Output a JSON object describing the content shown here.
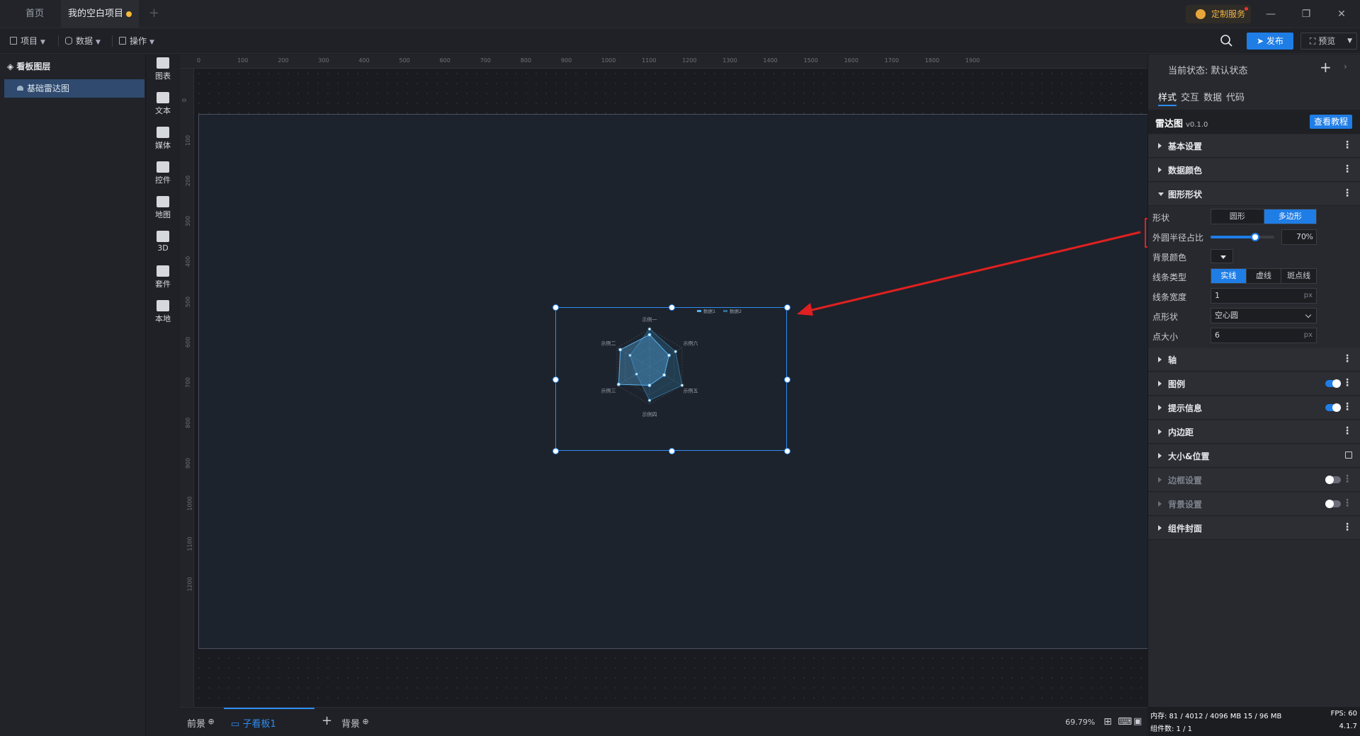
{
  "titlebar": {
    "tabs": [
      {
        "label": "首页"
      },
      {
        "label": "我的空白项目"
      }
    ],
    "service_label": "定制服务"
  },
  "toolbar": {
    "menus": [
      {
        "label": "项目"
      },
      {
        "label": "数据"
      },
      {
        "label": "操作"
      }
    ],
    "publish_label": "发布",
    "preview_label": "预览"
  },
  "layers": {
    "title": "看板图层",
    "items": [
      {
        "label": "基础雷达图"
      }
    ]
  },
  "components": [
    {
      "label": "图表",
      "icon": "chart-icon"
    },
    {
      "label": "文本",
      "icon": "text-icon"
    },
    {
      "label": "媒体",
      "icon": "media-icon"
    },
    {
      "label": "控件",
      "icon": "control-icon"
    },
    {
      "label": "地图",
      "icon": "map-icon"
    },
    {
      "label": "3D",
      "icon": "cube-icon"
    },
    {
      "label": "套件",
      "icon": "kit-icon"
    },
    {
      "label": "本地",
      "icon": "puzzle-icon"
    }
  ],
  "ruler": {
    "top": [
      "0",
      "100",
      "200",
      "300",
      "400",
      "500",
      "600",
      "700",
      "800",
      "900",
      "1000",
      "1100",
      "1200",
      "1300",
      "1400",
      "1500",
      "1600",
      "1700",
      "1800",
      "1900"
    ],
    "left": [
      "0",
      "100",
      "200",
      "300",
      "400",
      "500",
      "600",
      "700",
      "800",
      "900",
      "1000",
      "1100",
      "1200"
    ]
  },
  "chart_data": {
    "type": "radar",
    "indicators": [
      "示例一",
      "示例六",
      "示例五",
      "示例四",
      "示例三",
      "示例二"
    ],
    "max": 100,
    "series": [
      {
        "name": "数据1",
        "color": "#5ab1ef",
        "values": [
          85,
          60,
          45,
          50,
          95,
          90
        ]
      },
      {
        "name": "数据2",
        "color": "#2f6e94",
        "values": [
          100,
          80,
          100,
          90,
          40,
          60
        ]
      }
    ],
    "legend": "top-right"
  },
  "bottombar": {
    "tabs": [
      {
        "label": "前景"
      },
      {
        "label": "子看板1"
      },
      {
        "label": "背景"
      }
    ],
    "zoom": "69.79%"
  },
  "panel": {
    "state_label": "当前状态:",
    "state_value": "默认状态",
    "tabs": [
      {
        "label": "样式"
      },
      {
        "label": "交互"
      },
      {
        "label": "数据"
      },
      {
        "label": "代码"
      }
    ],
    "component_name": "雷达图",
    "component_version": "v0.1.0",
    "tutorial_label": "查看教程",
    "sections": {
      "basic": "基本设置",
      "data_color": "数据颜色",
      "shape_section": "图形形状",
      "axis": "轴",
      "legend": "图例",
      "tooltip": "提示信息",
      "padding": "内边距",
      "size_pos": "大小&位置",
      "border": "边框设置",
      "background": "背景设置",
      "cover": "组件封面"
    },
    "shape": {
      "shape_label": "形状",
      "shape_options": [
        "圆形",
        "多边形"
      ],
      "shape_selected": "多边形",
      "radius_label": "外圆半径占比",
      "radius_value": "70",
      "radius_unit": "%",
      "radius_fraction": 0.7,
      "bgcolor_label": "背景颜色",
      "line_type_label": "线条类型",
      "line_types": [
        "实线",
        "虚线",
        "斑点线"
      ],
      "line_type_selected": "实线",
      "line_width_label": "线条宽度",
      "line_width": "1",
      "point_shape_label": "点形状",
      "point_shape": "空心圆",
      "point_size_label": "点大小",
      "point_size": "6",
      "px_unit": "px"
    }
  },
  "status": {
    "memory": "内存: 81 / 4012 / 4096 MB 15 / 96 MB",
    "fps": "FPS: 60",
    "count": "组件数: 1 / 1",
    "version": "4.1.7"
  }
}
